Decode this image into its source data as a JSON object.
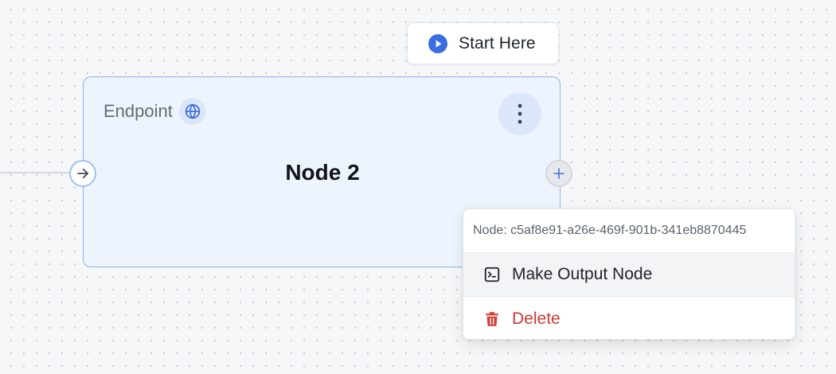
{
  "start_badge": {
    "label": "Start Here",
    "icon": "play-circle-icon",
    "icon_color": "#3a6ee0"
  },
  "node": {
    "type_label": "Endpoint",
    "type_icon": "globe-icon",
    "title": "Node 2",
    "menu_icon": "vertical-dots-icon",
    "input_handle_icon": "arrow-right-icon",
    "output_handle_icon": "plus-icon",
    "accent": "#8fb0ec",
    "background": "#eef4fe"
  },
  "context_menu": {
    "header": "Node: c5af8e91-a26e-469f-901b-341eb8870445",
    "items": [
      {
        "label": "Make Output Node",
        "icon": "terminal-icon",
        "color": "#1f2328"
      },
      {
        "label": "Delete",
        "icon": "trash-icon",
        "color": "#cd3b35"
      }
    ]
  }
}
